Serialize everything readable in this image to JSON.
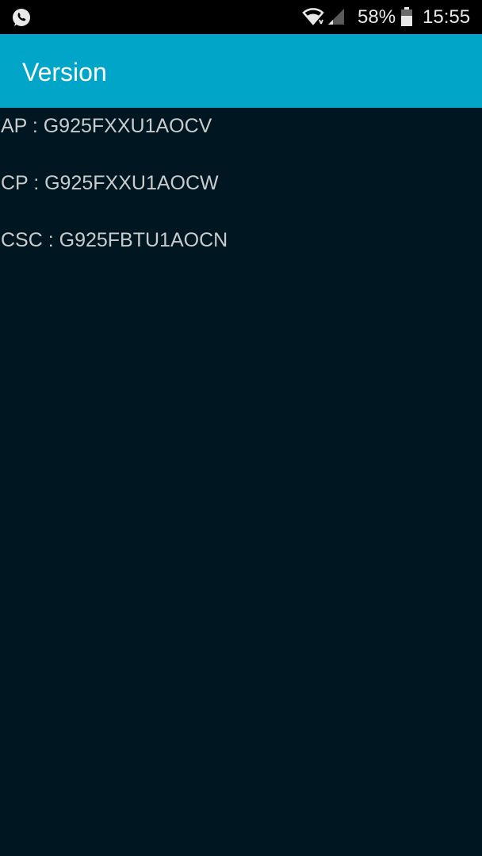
{
  "status_bar": {
    "notification_icon": "whatsapp-icon",
    "wifi_icon": "wifi-icon",
    "signal_icon": "cellular-signal-icon",
    "battery_percent": "58%",
    "battery_icon": "battery-icon",
    "time": "15:55"
  },
  "app_bar": {
    "title": "Version",
    "background_color": "#00a5c8"
  },
  "versions": {
    "ap": "AP : G925FXXU1AOCV",
    "cp": "CP : G925FXXU1AOCW",
    "csc": "CSC : G925FBTU1AOCN"
  },
  "colors": {
    "background": "#001620",
    "text": "#c9ccce",
    "status_bar": "#000000"
  }
}
